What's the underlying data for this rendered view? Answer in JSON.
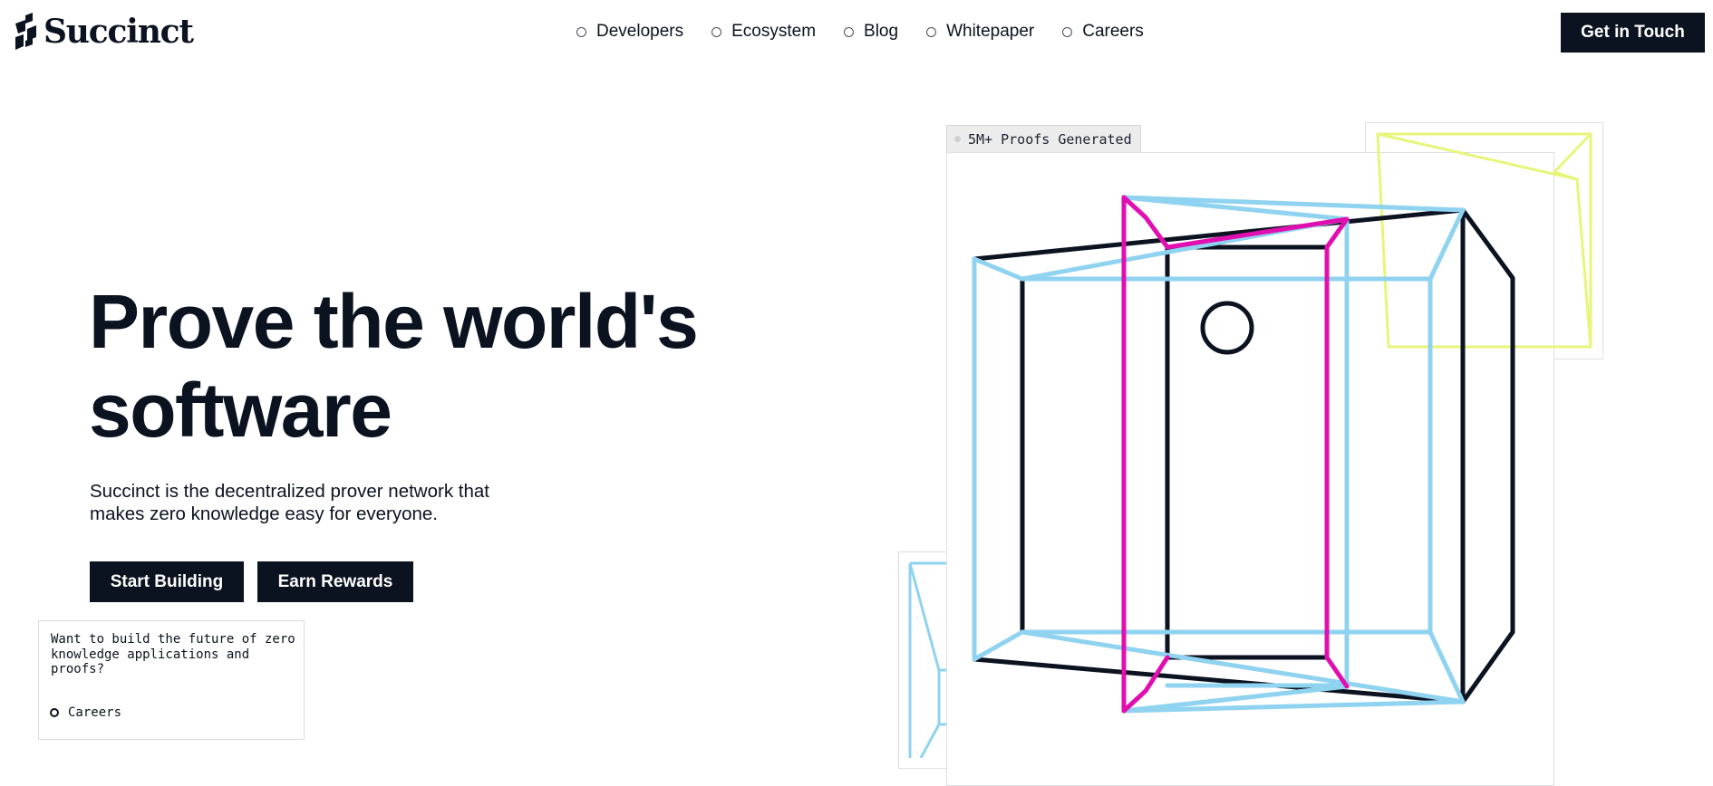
{
  "brand": {
    "name": "Succinct"
  },
  "nav": [
    {
      "label": "Developers"
    },
    {
      "label": "Ecosystem"
    },
    {
      "label": "Blog"
    },
    {
      "label": "Whitepaper"
    },
    {
      "label": "Careers"
    }
  ],
  "header": {
    "cta_label": "Get in Touch"
  },
  "hero": {
    "headline_line1": "Prove the world's",
    "headline_line2": "software",
    "subtext": "Succinct is the decentralized prover network that makes zero knowledge easy for everyone.",
    "primary_button": "Start Building",
    "secondary_button": "Earn Rewards"
  },
  "card": {
    "text": "Want to build the future of zero knowledge applications and proofs?",
    "link_label": "Careers"
  },
  "illustration": {
    "stat_tag": "5M+ Proofs Generated",
    "colors": {
      "navy": "#0b1220",
      "sky": "#8fd3f0",
      "magenta": "#e10fb0",
      "yellow": "#e8f57a"
    }
  }
}
